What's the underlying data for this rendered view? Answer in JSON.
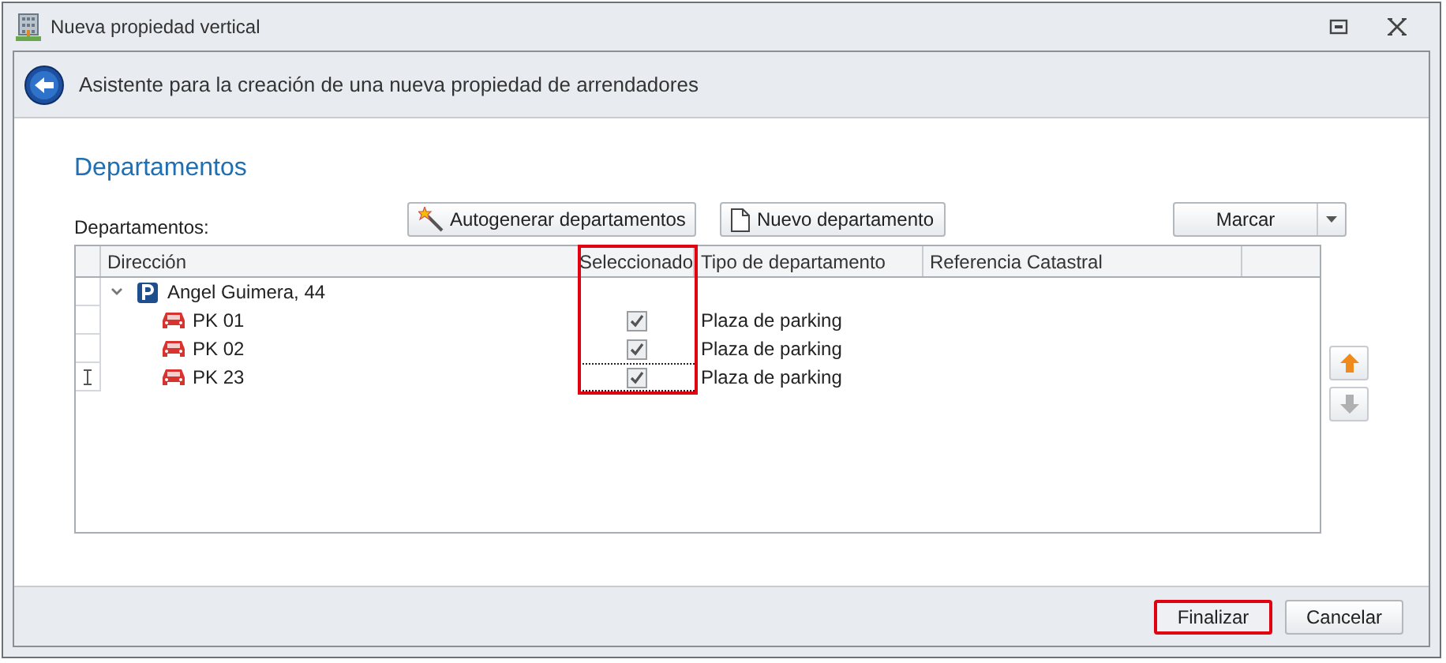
{
  "window": {
    "title": "Nueva propiedad vertical"
  },
  "header": {
    "text": "Asistente para la creación de una nueva propiedad de arrendadores"
  },
  "section_title": "Departamentos",
  "toolbar": {
    "label": "Departamentos:",
    "buttons": [
      {
        "label": "Autogenerar departamentos",
        "kind": "wand"
      },
      {
        "label": "Nuevo departamento",
        "kind": "page"
      }
    ],
    "split_button": {
      "label": "Marcar"
    }
  },
  "grid": {
    "columns": [
      {
        "label": "Dirección",
        "highlighted": false
      },
      {
        "label": "Seleccionado",
        "highlighted": true
      },
      {
        "label": "Tipo de departamento",
        "highlighted": false
      },
      {
        "label": "Referencia Catastral",
        "highlighted": false
      }
    ],
    "rows": [
      {
        "name": "Angel Guimera, 44",
        "kind": "building",
        "expanded": true,
        "children": [
          {
            "name": "PK 01",
            "kind": "parking",
            "checked": true,
            "type": "Plaza de parking",
            "focused": false
          },
          {
            "name": "PK 02",
            "kind": "parking",
            "checked": true,
            "type": "Plaza de parking",
            "focused": false
          },
          {
            "name": "PK 23",
            "kind": "parking",
            "checked": true,
            "type": "Plaza de parking",
            "focused": true
          }
        ]
      }
    ]
  },
  "move_buttons": [
    {
      "kind": "up",
      "disabled": false
    },
    {
      "kind": "down",
      "disabled": true
    }
  ],
  "footer": {
    "buttons": [
      {
        "label": "Finalizar",
        "highlighted": true
      },
      {
        "label": "Cancelar",
        "highlighted": false
      }
    ]
  }
}
